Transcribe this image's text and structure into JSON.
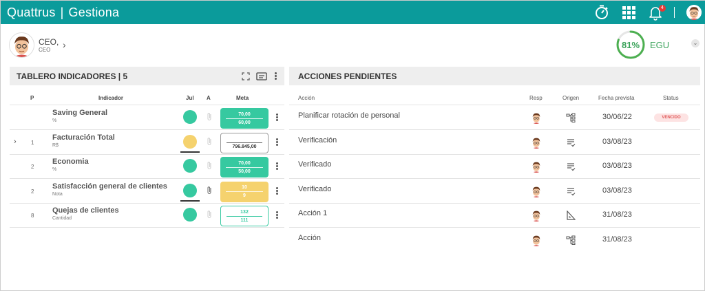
{
  "app": {
    "brand": "Quattrus",
    "module": "Gestiona"
  },
  "header": {
    "notification_count": "4"
  },
  "user": {
    "name": "CEO,",
    "role": "CEO"
  },
  "score": {
    "percent_label": "81%",
    "percent_value": 81,
    "unit": "EGU",
    "color": "#4caf50"
  },
  "left_panel": {
    "title": "TABLERO INDICADORES | 5",
    "columns": {
      "p": "P",
      "indicator": "Indicador",
      "month": "Jul",
      "a": "A",
      "goal": "Meta"
    },
    "rows": [
      {
        "p": "",
        "name": "Saving General",
        "unit": "%",
        "status_color": "#36c9a0",
        "underline": false,
        "clip_active": false,
        "goal_top": "70,00",
        "goal_bottom": "60,00",
        "goal_style": "green",
        "expand": false
      },
      {
        "p": "1",
        "name": "Facturación Total",
        "unit": "R$",
        "status_color": "#f5d26e",
        "underline": true,
        "clip_active": false,
        "goal_top": "",
        "goal_bottom": "796.845,00",
        "goal_style": "outline",
        "expand": true
      },
      {
        "p": "2",
        "name": "Economia",
        "unit": "%",
        "status_color": "#36c9a0",
        "underline": false,
        "clip_active": false,
        "goal_top": "70,00",
        "goal_bottom": "50,00",
        "goal_style": "green",
        "expand": false
      },
      {
        "p": "2",
        "name": "Satisfacción general de clientes",
        "unit": "Nota",
        "status_color": "#36c9a0",
        "underline": true,
        "clip_active": true,
        "goal_top": "10",
        "goal_bottom": "9",
        "goal_style": "yellow",
        "expand": false
      },
      {
        "p": "8",
        "name": "Quejas de clientes",
        "unit": "Cantidad",
        "status_color": "#36c9a0",
        "underline": false,
        "clip_active": false,
        "goal_top": "132",
        "goal_bottom": "111",
        "goal_style": "green-outline",
        "expand": false
      }
    ]
  },
  "right_panel": {
    "title": "ACCIONES PENDIENTES",
    "columns": {
      "action": "Acción",
      "resp": "Resp",
      "origin": "Origen",
      "date": "Fecha prevista",
      "status": "Status"
    },
    "rows": [
      {
        "action": "Planificar rotación de personal",
        "origin_icon": "hierarchy-icon",
        "date": "30/06/22",
        "status": "VENCIDO"
      },
      {
        "action": "Verificación",
        "origin_icon": "checklist-icon",
        "date": "03/08/23",
        "status": ""
      },
      {
        "action": "Verificado",
        "origin_icon": "checklist-icon",
        "date": "03/08/23",
        "status": ""
      },
      {
        "action": "Verificado",
        "origin_icon": "checklist-icon",
        "date": "03/08/23",
        "status": ""
      },
      {
        "action": "Acción 1",
        "origin_icon": "triangle-ruler-icon",
        "date": "31/08/23",
        "status": ""
      },
      {
        "action": "Acción",
        "origin_icon": "hierarchy-icon",
        "date": "31/08/23",
        "status": ""
      }
    ]
  },
  "colors": {
    "topbar": "#0b9b9b",
    "green": "#36c9a0",
    "yellow": "#f5d26e",
    "overdue": "#e05a5a"
  }
}
